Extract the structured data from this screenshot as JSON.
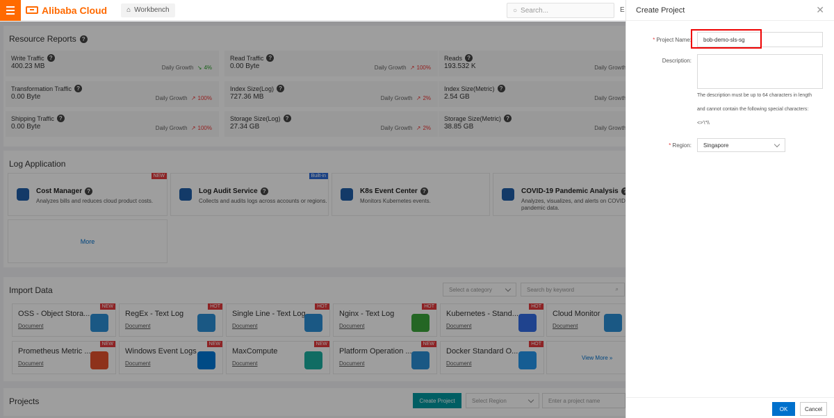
{
  "topbar": {
    "logo": "Alibaba Cloud",
    "workbench": "Workbench",
    "search_placeholder": "Search...",
    "edge_text": "E"
  },
  "resource_reports": {
    "title": "Resource Reports",
    "growth_label": "Daily Growth",
    "cells": [
      {
        "label": "Write Traffic",
        "value": "400.23  MB",
        "growth": "4%",
        "trend": "flat"
      },
      {
        "label": "Read Traffic",
        "value": "0.00  Byte",
        "growth": "100%",
        "trend": "up"
      },
      {
        "label": "Reads",
        "value": "193.532  K",
        "growth": "",
        "trend": "none"
      },
      {
        "label": "Transformation Traffic",
        "value": "0.00  Byte",
        "growth": "100%",
        "trend": "up"
      },
      {
        "label": "Index Size(Log)",
        "value": "727.36  MB",
        "growth": "2%",
        "trend": "up"
      },
      {
        "label": "Index Size(Metric)",
        "value": "2.54  GB",
        "growth": "",
        "trend": "none"
      },
      {
        "label": "Shipping Traffic",
        "value": "0.00  Byte",
        "growth": "100%",
        "trend": "up"
      },
      {
        "label": "Storage Size(Log)",
        "value": "27.34  GB",
        "growth": "2%",
        "trend": "up"
      },
      {
        "label": "Storage Size(Metric)",
        "value": "38.85  GB",
        "growth": "",
        "trend": "none"
      }
    ]
  },
  "log_application": {
    "title": "Log Application",
    "apps": [
      {
        "name": "Cost Manager",
        "desc": "Analyzes bills and reduces cloud product costs.",
        "badge": "NEW",
        "color": "#1f5ea8"
      },
      {
        "name": "Log Audit Service",
        "desc": "Collects and audits logs across accounts or regions.",
        "badge": "Built-in",
        "color": "#1f5ea8"
      },
      {
        "name": "K8s Event Center",
        "desc": "Monitors Kubernetes events.",
        "badge": "",
        "color": "#1f5ea8"
      },
      {
        "name": "COVID-19 Pandemic Analysis",
        "desc": "Analyzes, visualizes, and alerts on COVID-19 pandemic data.",
        "badge": "",
        "color": "#1f5ea8"
      }
    ],
    "more": "More"
  },
  "import_data": {
    "title": "Import Data",
    "category_placeholder": "Select a category",
    "keyword_placeholder": "Search by keyword",
    "doc_label": "Document",
    "view_more": "View More »",
    "cards": [
      {
        "title": "OSS - Object Stora...",
        "badge": "NEW",
        "color": "#2b8fd6"
      },
      {
        "title": "RegEx - Text Log",
        "badge": "HOT",
        "color": "#2b8fd6"
      },
      {
        "title": "Single Line - Text Log",
        "badge": "HOT",
        "color": "#2b8fd6"
      },
      {
        "title": "Nginx - Text Log",
        "badge": "HOT",
        "color": "#3aa53a"
      },
      {
        "title": "Kubernetes - Stand...",
        "badge": "HOT",
        "color": "#326ce5"
      },
      {
        "title": "Cloud Monitor",
        "badge": "",
        "color": "#2b8fd6"
      },
      {
        "title": "Prometheus Metric ...",
        "badge": "NEW",
        "color": "#e6522c"
      },
      {
        "title": "Windows Event Logs",
        "badge": "NEW",
        "color": "#0078d7"
      },
      {
        "title": "MaxCompute",
        "badge": "NEW",
        "color": "#1aaea0"
      },
      {
        "title": "Platform Operation ...",
        "badge": "NEW",
        "color": "#2b8fd6"
      },
      {
        "title": "Docker Standard O...",
        "badge": "HOT",
        "color": "#2496ed"
      }
    ]
  },
  "projects": {
    "title": "Projects",
    "create_button": "Create Project",
    "region_placeholder": "Select Region",
    "name_placeholder": "Enter a project name"
  },
  "drawer": {
    "title": "Create Project",
    "project_name_label": "Project Name:",
    "project_name_value": "bob-demo-sls-sg",
    "description_label": "Description:",
    "hint_line1": "The description must be up to 64 characters in length",
    "hint_line2": "and cannot contain the following special characters:",
    "hint_line3": "<>'\\\"\\\\",
    "region_label": "Region:",
    "region_value": "Singapore",
    "ok": "OK",
    "cancel": "Cancel"
  }
}
